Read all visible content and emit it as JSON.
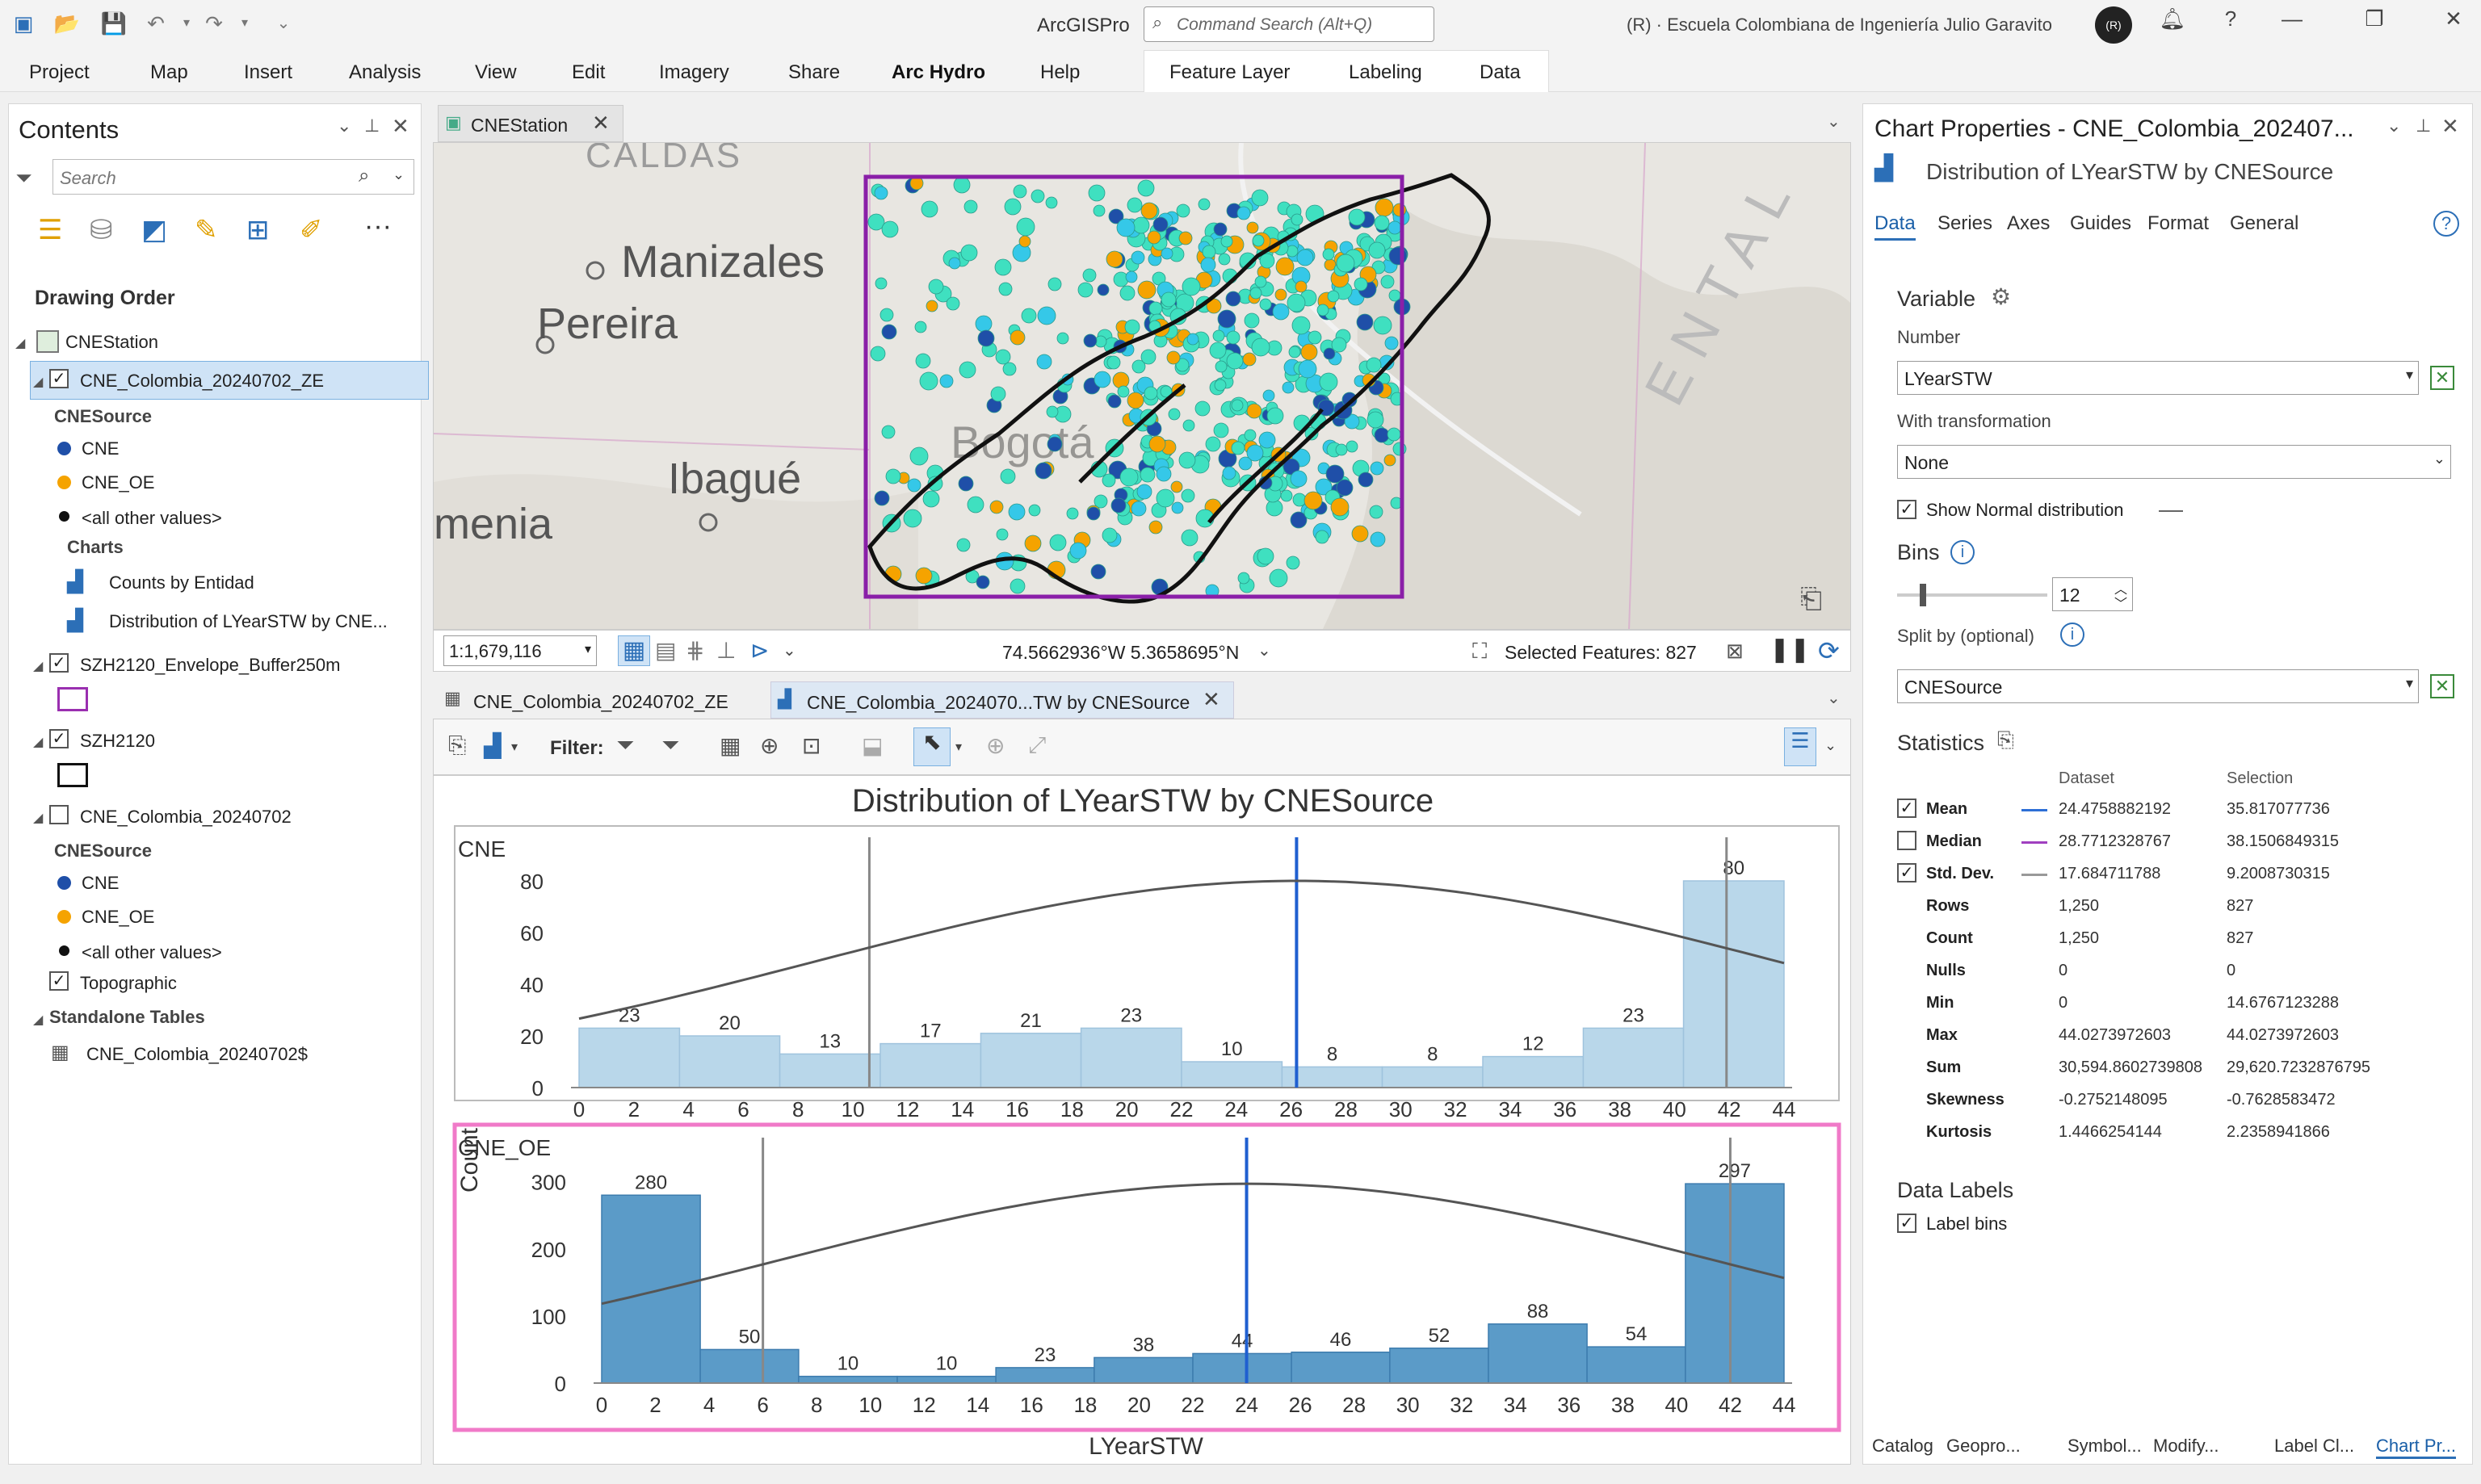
{
  "app": {
    "name": "ArcGISPro",
    "search_placeholder": "Command Search (Alt+Q)",
    "user": "(R) · Escuela Colombiana de Ingeniería Julio Garavito",
    "avatar": "(R)"
  },
  "ribbon": {
    "tabs": [
      "Project",
      "Map",
      "Insert",
      "Analysis",
      "View",
      "Edit",
      "Imagery",
      "Share",
      "Arc Hydro",
      "Help"
    ],
    "active": "Arc Hydro",
    "context_tabs": [
      "Feature Layer",
      "Labeling",
      "Data"
    ]
  },
  "contents": {
    "title": "Contents",
    "search_placeholder": "Search",
    "drawing_order": "Drawing Order",
    "map_name": "CNEStation",
    "layer1": "CNE_Colombia_20240702_ZE",
    "field1": "CNESource",
    "cls_cne": "CNE",
    "cls_oe": "CNE_OE",
    "cls_other": "<all other values>",
    "charts_head": "Charts",
    "chart1": "Counts by Entidad",
    "chart2": "Distribution of LYearSTW by CNE...",
    "layer2": "SZH2120_Envelope_Buffer250m",
    "layer3": "SZH2120",
    "layer4": "CNE_Colombia_20240702",
    "field4": "CNESource",
    "cls4_cne": "CNE",
    "cls4_oe": "CNE_OE",
    "cls4_other": "<all other values>",
    "layer5": "Topographic",
    "standalone": "Standalone Tables",
    "table1": "CNE_Colombia_20240702$"
  },
  "map": {
    "tab": "CNEStation",
    "labels": [
      "CALDAS",
      "Manizales",
      "Pereira",
      "Ibagué",
      "menia",
      "Bogotá"
    ],
    "scale": "1:1,679,116",
    "coords": "74.5662936°W 5.3658695°N",
    "selected": "Selected Features: 827"
  },
  "lower_tabs": {
    "t1": "CNE_Colombia_20240702_ZE",
    "t2": "CNE_Colombia_2024070...TW by CNESource"
  },
  "toolbar": {
    "filter": "Filter:"
  },
  "chart_data": {
    "type": "bar",
    "title": "Distribution of LYearSTW by CNESource",
    "xlabel": "LYearSTW",
    "ylabel": "Count",
    "x_ticks": [
      0,
      2,
      4,
      6,
      8,
      10,
      12,
      14,
      16,
      18,
      20,
      22,
      24,
      26,
      28,
      30,
      32,
      34,
      36,
      38,
      40,
      42,
      44
    ],
    "panels": [
      {
        "name": "CNE",
        "bin_edges": [
          0,
          3.67,
          7.33,
          11,
          14.67,
          18.33,
          22,
          25.67,
          29.33,
          33,
          36.67,
          40.33,
          44
        ],
        "values": [
          23,
          20,
          13,
          17,
          21,
          23,
          10,
          8,
          8,
          12,
          23,
          80
        ],
        "ylim": [
          0,
          85
        ],
        "y_ticks": [
          0,
          20,
          40,
          60,
          80
        ],
        "mean": 26.2,
        "std_lines": [
          10.6,
          41.9
        ],
        "color": "#b9d7ea",
        "normal_peak": 80
      },
      {
        "name": "CNE_OE",
        "bin_edges": [
          0,
          3.67,
          7.33,
          11,
          14.67,
          18.33,
          22,
          25.67,
          29.33,
          33,
          36.67,
          40.33,
          44
        ],
        "values": [
          280,
          50,
          10,
          10,
          23,
          38,
          44,
          46,
          52,
          88,
          54,
          297
        ],
        "ylim": [
          0,
          320
        ],
        "y_ticks": [
          0,
          100,
          200,
          300
        ],
        "mean": 24.0,
        "std_lines": [
          6.0,
          42.0
        ],
        "color": "#5b9bc8",
        "normal_peak": 297
      }
    ]
  },
  "props": {
    "title": "Chart Properties - CNE_Colombia_202407...",
    "subtitle": "Distribution of LYearSTW by CNESource",
    "tabs": [
      "Data",
      "Series",
      "Axes",
      "Guides",
      "Format",
      "General"
    ],
    "active_tab": "Data",
    "variable": "Variable",
    "number": "Number",
    "number_val": "LYearSTW",
    "transform": "With transformation",
    "transform_val": "None",
    "show_normal": "Show Normal distribution",
    "bins": "Bins",
    "bins_val": "12",
    "split": "Split by (optional)",
    "split_val": "CNESource",
    "statistics": "Statistics",
    "col_dataset": "Dataset",
    "col_selection": "Selection",
    "stats": [
      {
        "label": "Mean",
        "checked": true,
        "line": "#2d6fd6",
        "d": "24.4758882192",
        "s": "35.817077736"
      },
      {
        "label": "Median",
        "checked": false,
        "line": "#a040c0",
        "d": "28.7712328767",
        "s": "38.1506849315"
      },
      {
        "label": "Std. Dev.",
        "checked": true,
        "line": "#999999",
        "d": "17.684711788",
        "s": "9.2008730315"
      },
      {
        "label": "Rows",
        "d": "1,250",
        "s": "827"
      },
      {
        "label": "Count",
        "d": "1,250",
        "s": "827"
      },
      {
        "label": "Nulls",
        "d": "0",
        "s": "0"
      },
      {
        "label": "Min",
        "d": "0",
        "s": "14.6767123288"
      },
      {
        "label": "Max",
        "d": "44.0273972603",
        "s": "44.0273972603"
      },
      {
        "label": "Sum",
        "d": "30,594.8602739808",
        "s": "29,620.7232876795"
      },
      {
        "label": "Skewness",
        "d": "-0.2752148095",
        "s": "-0.7628583472"
      },
      {
        "label": "Kurtosis",
        "d": "1.4466254144",
        "s": "2.2358941866"
      }
    ],
    "data_labels": "Data Labels",
    "label_bins": "Label bins"
  },
  "bottom_tabs": [
    "Catalog",
    "Geopro...",
    "Symbol...",
    "Modify...",
    "Label Cl...",
    "Chart Pr..."
  ]
}
